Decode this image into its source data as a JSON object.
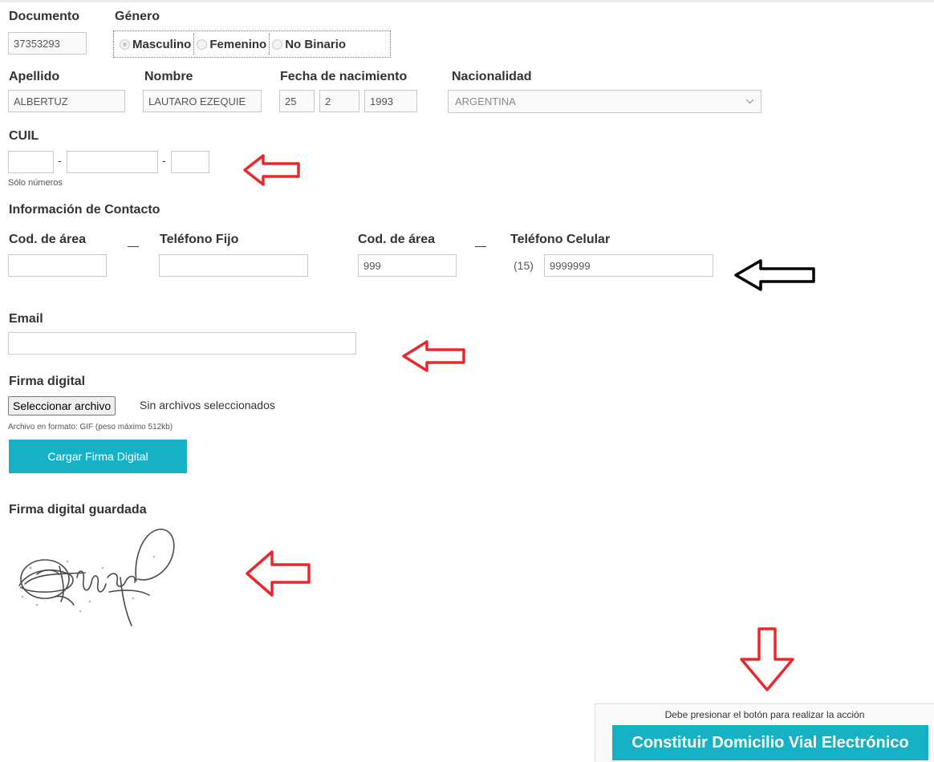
{
  "form": {
    "documento": {
      "label": "Documento",
      "value": "37353293"
    },
    "genero": {
      "label": "Género",
      "options": [
        {
          "label": "Masculino",
          "selected": true
        },
        {
          "label": "Femenino",
          "selected": false
        },
        {
          "label": "No Binario",
          "selected": false
        }
      ]
    },
    "apellido": {
      "label": "Apellido",
      "value": "ALBERTUZ"
    },
    "nombre": {
      "label": "Nombre",
      "value": "LAUTARO EZEQUIE"
    },
    "fecha_nacimiento": {
      "label": "Fecha de nacimiento",
      "day": "25",
      "month": "2",
      "year": "1993"
    },
    "nacionalidad": {
      "label": "Nacionalidad",
      "value": "ARGENTINA"
    },
    "cuil": {
      "label": "CUIL",
      "separator": "-",
      "hint": "Sólo números"
    },
    "contacto": {
      "heading": "Información de Contacto",
      "cod_area_label": "Cod. de área",
      "separator": "—",
      "telefono_fijo_label": "Teléfono Fijo",
      "cod_area_cel_label": "Cod. de área",
      "telefono_celular_label": "Teléfono Celular",
      "cod_area_cel_value": "999",
      "celular_prefix": "(15)",
      "celular_value": "9999999"
    },
    "email": {
      "label": "Email",
      "value": ""
    },
    "firma": {
      "label": "Firma digital",
      "file_button": "Seleccionar archivo",
      "file_status": "Sin archivos seleccionados",
      "hint": "Archivo en formato: GIF (peso máximo 512kb)",
      "upload_button": "Cargar Firma Digital",
      "saved_label": "Firma digital guardada"
    }
  },
  "action_panel": {
    "note": "Debe presionar el botón para realizar la acción",
    "button": "Constituir Domicilio Vial Electrónico"
  },
  "colors": {
    "accent": "#17b1c6",
    "annotation_red": "#e8282b",
    "annotation_black": "#000000"
  }
}
